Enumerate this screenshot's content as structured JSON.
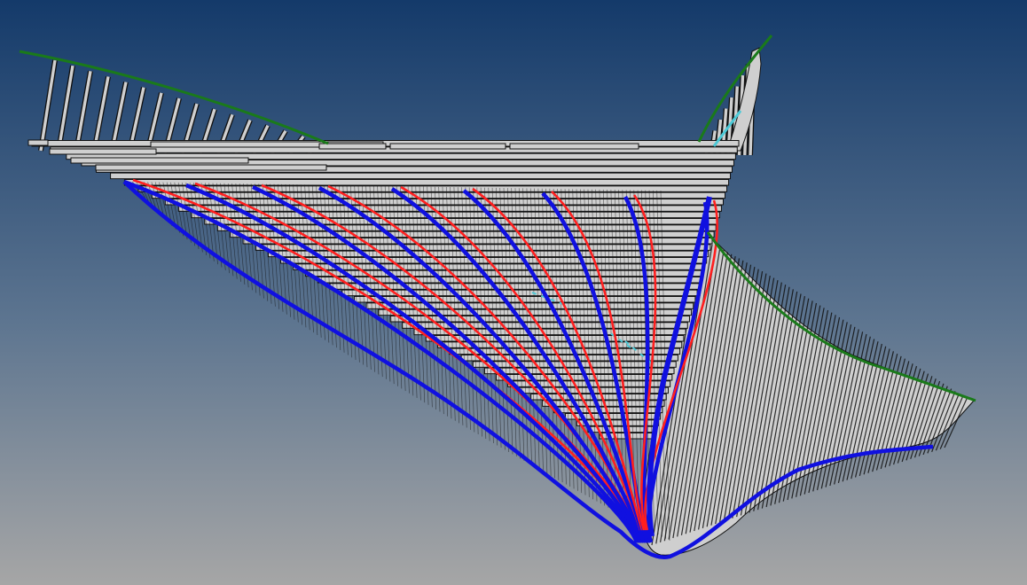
{
  "viewport": {
    "background_top": "#143a6a",
    "background_bottom": "#a6a6a6",
    "panel_fill": "#cfcfcf",
    "panel_edge": "#111111",
    "sheer_curve_color": "#1a7a1a",
    "cyan_trace_color": "#4cc9d6",
    "inner_curve_color": "#ff1f1f",
    "outer_curve_color": "#1010e0"
  }
}
